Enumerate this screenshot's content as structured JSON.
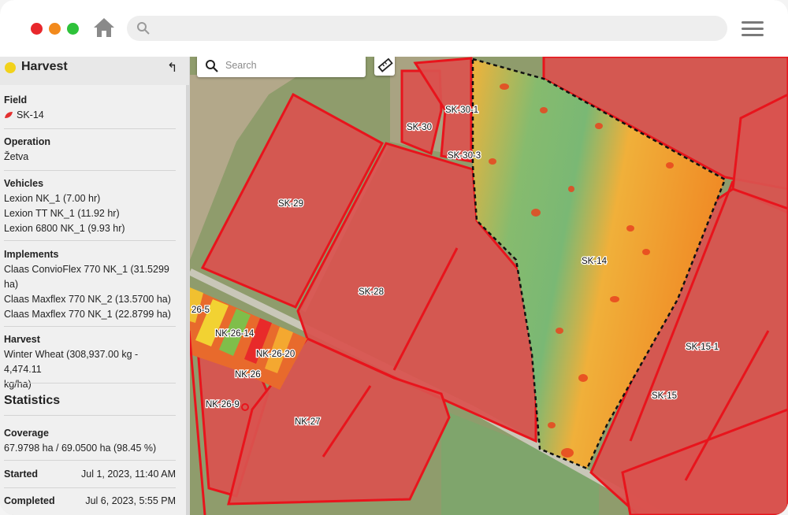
{
  "window": {
    "dots": [
      "#e8272c",
      "#f28a1d",
      "#2ec23a"
    ]
  },
  "sidebar": {
    "title": "Harvest",
    "status_color": "#f2d21b",
    "back_icon": "↰",
    "field": {
      "label": "Field",
      "value": "SK-14"
    },
    "operation": {
      "label": "Operation",
      "value": "Žetva"
    },
    "vehicles": {
      "label": "Vehicles",
      "items": [
        "Lexion NK_1 (7.00 hr)",
        "Lexion TT NK_1 (11.92 hr)",
        "Lexion 6800 NK_1 (9.93 hr)"
      ]
    },
    "implements": {
      "label": "Implements",
      "items": [
        "Claas ConvioFlex 770 NK_1 (31.5299",
        "ha)",
        "Claas Maxflex 770 NK_2 (13.5700 ha)",
        "Claas Maxflex 770 NK_1 (22.8799 ha)"
      ]
    },
    "harvest": {
      "label": "Harvest",
      "lines": [
        "Winter Wheat (308,937.00 kg - 4,474.11",
        "kg/ha)"
      ]
    },
    "statistics": {
      "title": "Statistics",
      "coverage_label": "Coverage",
      "coverage_value": "67.9798 ha / 69.0500 ha (98.45 %)",
      "started_label": "Started",
      "started_value": "Jul 1, 2023, 11:40 AM",
      "completed_label": "Completed",
      "completed_value": "Jul 6, 2023, 5:55 PM"
    }
  },
  "map": {
    "search_placeholder": "Search",
    "field_labels": [
      "SK-30-1",
      "SK-30",
      "SK-30-3",
      "SK-29",
      "SK-14",
      "SK-28",
      "26-5",
      "NK-26-14",
      "NK-26-20",
      "NK-26",
      "NK-26-9",
      "NK-27",
      "SK-15-1",
      "SK-15"
    ],
    "colors": {
      "field_red": "#d9534f",
      "boundary_red": "#e8141c",
      "yield_high": "#6fb56d",
      "yield_low": "#f08a25"
    }
  }
}
